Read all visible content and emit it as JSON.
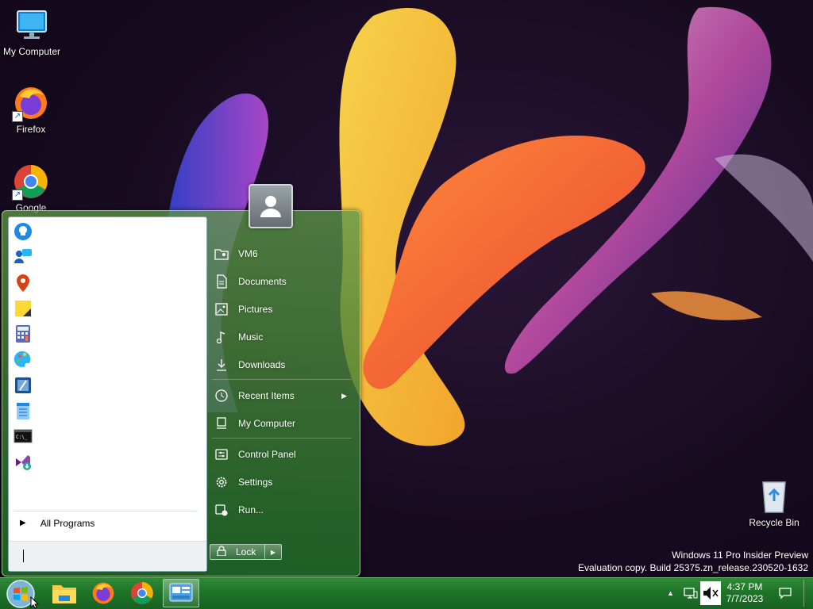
{
  "desktop": {
    "icons": [
      {
        "label": "My Computer",
        "icon": "monitor-icon"
      },
      {
        "label": "Firefox",
        "icon": "firefox-icon"
      },
      {
        "label": "Google",
        "icon": "chrome-icon"
      },
      {
        "label": "Recycle Bin",
        "icon": "recycle-bin-icon"
      }
    ]
  },
  "start_menu": {
    "pinned_apps": [
      {
        "icon": "tips-icon"
      },
      {
        "icon": "get-help-icon"
      },
      {
        "icon": "maps-icon"
      },
      {
        "icon": "sticky-notes-icon"
      },
      {
        "icon": "calculator-icon"
      },
      {
        "icon": "paint-icon"
      },
      {
        "icon": "snipping-tool-icon"
      },
      {
        "icon": "notepad-icon"
      },
      {
        "icon": "terminal-icon"
      },
      {
        "icon": "visual-studio-installer-icon"
      }
    ],
    "all_programs_label": "All Programs",
    "search_value": "",
    "right_items": [
      {
        "label": "VM6",
        "icon": "user-folder-icon"
      },
      {
        "label": "Documents",
        "icon": "document-icon"
      },
      {
        "label": "Pictures",
        "icon": "picture-icon"
      },
      {
        "label": "Music",
        "icon": "music-icon"
      },
      {
        "label": "Downloads",
        "icon": "download-icon"
      },
      {
        "label": "Recent Items",
        "icon": "clock-icon",
        "has_submenu": true
      },
      {
        "label": "My Computer",
        "icon": "computer-icon"
      },
      {
        "label": "Control Panel",
        "icon": "control-panel-icon"
      },
      {
        "label": "Settings",
        "icon": "gear-icon"
      },
      {
        "label": "Run...",
        "icon": "run-icon"
      }
    ],
    "lock_label": "Lock"
  },
  "watermark": {
    "line1": "Windows 11 Pro Insider Preview",
    "line2": "Evaluation copy. Build 25375.zn_release.230520-1632"
  },
  "taskbar": {
    "apps": [
      {
        "icon": "file-explorer-icon"
      },
      {
        "icon": "firefox-icon"
      },
      {
        "icon": "chrome-icon"
      },
      {
        "icon": "control-panel-icon",
        "active": true
      }
    ],
    "clock": {
      "time": "4:37 PM",
      "date": "7/7/2023"
    }
  },
  "colors": {
    "taskbar": "#1f7429",
    "start_menu_tint": "#3f8a3c"
  }
}
